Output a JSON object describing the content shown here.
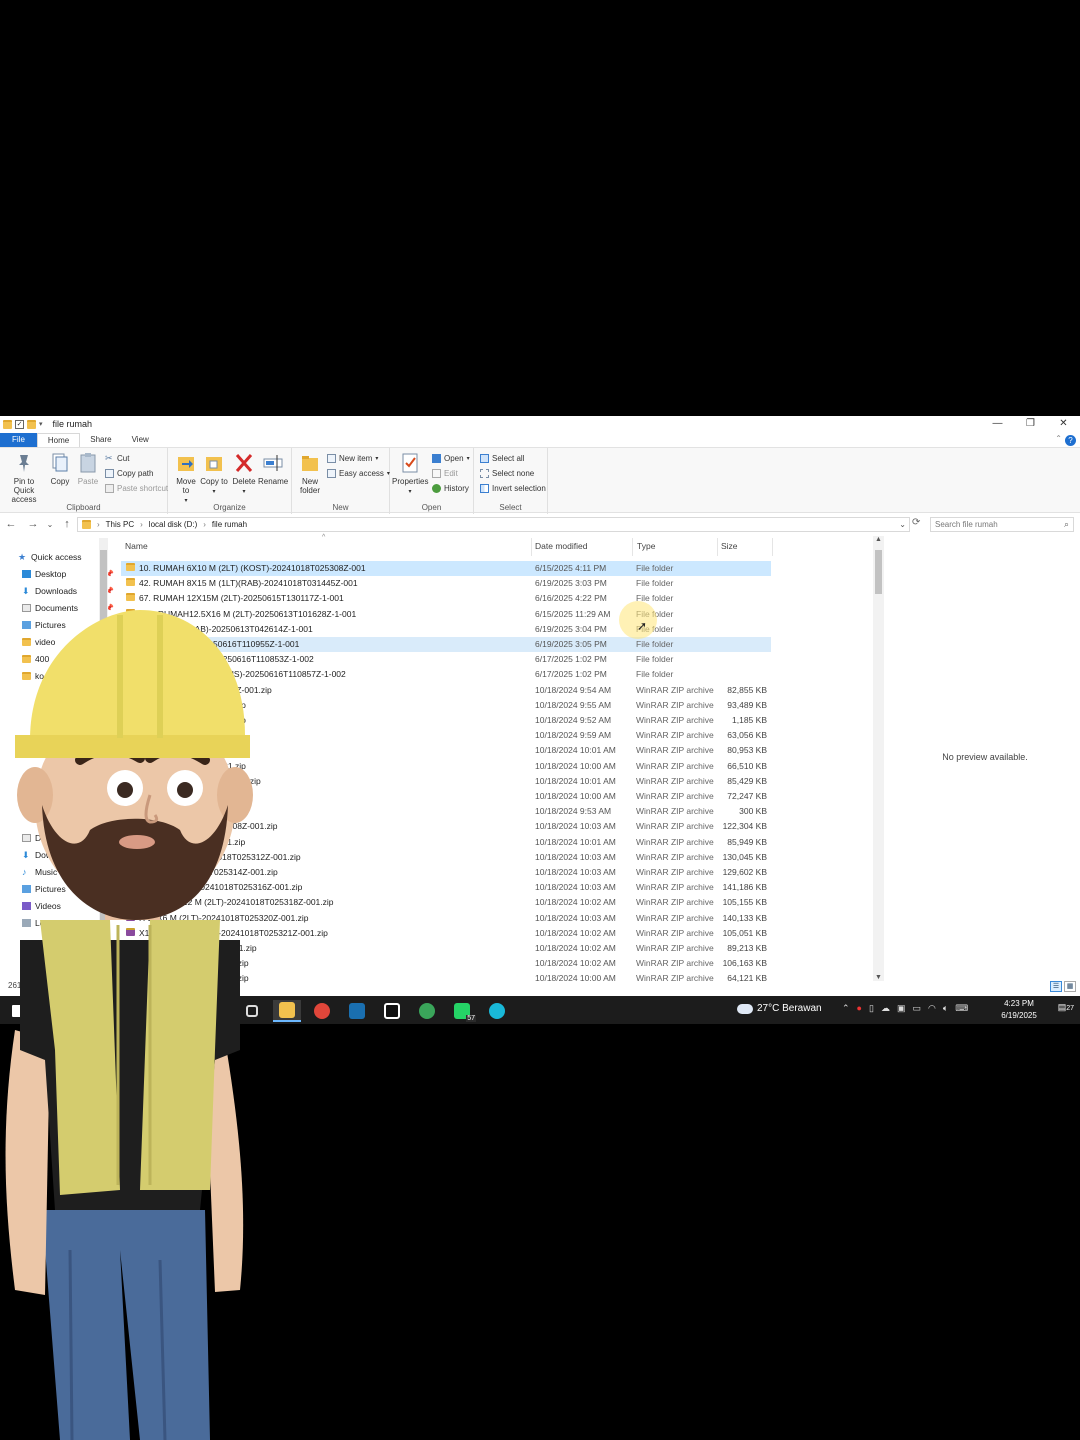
{
  "window": {
    "title": "file rumah",
    "controls": [
      "—",
      "❐",
      "✕"
    ]
  },
  "ribbon_tabs": [
    "File",
    "Home",
    "Share",
    "View"
  ],
  "ribbon": {
    "clipboard": {
      "label": "Clipboard",
      "pin": "Pin to Quick access",
      "copy": "Copy",
      "paste": "Paste",
      "cut": "Cut",
      "copy_path": "Copy path",
      "paste_shortcut": "Paste shortcut"
    },
    "organize": {
      "label": "Organize",
      "move_to": "Move to",
      "copy_to": "Copy to",
      "delete": "Delete",
      "rename": "Rename"
    },
    "new": {
      "label": "New",
      "new_folder": "New folder",
      "new_item": "New item",
      "easy_access": "Easy access"
    },
    "open": {
      "label": "Open",
      "properties": "Properties",
      "open": "Open",
      "edit": "Edit",
      "history": "History"
    },
    "select": {
      "label": "Select",
      "select_all": "Select all",
      "select_none": "Select none",
      "invert": "Invert selection"
    }
  },
  "address": {
    "crumbs": [
      "This PC",
      "local disk (D:)",
      "file rumah"
    ],
    "search_placeholder": "Search file rumah"
  },
  "nav_pane": {
    "items": [
      {
        "label": "Quick access",
        "icon": "star-icon",
        "pinned": false
      },
      {
        "label": "Desktop",
        "icon": "desktop-icon",
        "pinned": true
      },
      {
        "label": "Downloads",
        "icon": "download-icon",
        "pinned": true
      },
      {
        "label": "Documents",
        "icon": "document-icon",
        "pinned": true
      },
      {
        "label": "Pictures",
        "icon": "pictures-icon",
        "pinned": false
      },
      {
        "label": "video",
        "icon": "folder-icon",
        "pinned": false
      },
      {
        "label": "400",
        "icon": "folder-icon",
        "pinned": false
      },
      {
        "label": "ko",
        "icon": "folder-icon",
        "pinned": false
      },
      {
        "label": "Docu",
        "icon": "document-icon",
        "pinned": false
      },
      {
        "label": "Downl",
        "icon": "download-icon",
        "pinned": false
      },
      {
        "label": "Music",
        "icon": "music-icon",
        "pinned": false
      },
      {
        "label": "Pictures",
        "icon": "pictures-icon",
        "pinned": false
      },
      {
        "label": "Videos",
        "icon": "videos-icon",
        "pinned": false
      },
      {
        "label": "Local Disk",
        "icon": "drive-icon",
        "pinned": false
      }
    ]
  },
  "columns": {
    "name": "Name",
    "date": "Date modified",
    "type": "Type",
    "size": "Size"
  },
  "files": [
    {
      "name": "10. RUMAH 6X10 M (2LT) (KOST)-20241018T025308Z-001",
      "date": "6/15/2025 4:11 PM",
      "type": "File folder",
      "size": "",
      "kind": "folder",
      "state": "selected"
    },
    {
      "name": "42. RUMAH 8X15 M (1LT)(RAB)-20241018T031445Z-001",
      "date": "6/19/2025 3:03 PM",
      "type": "File folder",
      "size": "",
      "kind": "folder",
      "state": ""
    },
    {
      "name": "67. RUMAH 12X15M (2LT)-20250615T130117Z-1-001",
      "date": "6/16/2025 4:22 PM",
      "type": "File folder",
      "size": "",
      "kind": "folder",
      "state": ""
    },
    {
      "name": "#07. RUMAH12.5X16 M (2LT)-20250613T101628Z-1-001",
      "date": "6/15/2025 11:29 AM",
      "type": "File folder",
      "size": "",
      "kind": "folder",
      "state": ""
    },
    {
      "name": "X10 M (1LT)(RAB)-20250613T042614Z-1-001",
      "date": "6/19/2025 3:04 PM",
      "type": "File folder",
      "size": "",
      "kind": "folder",
      "state": ""
    },
    {
      "name": "M (2 LT) (RAB)-20250616T110955Z-1-001",
      "date": "6/19/2025 3:05 PM",
      "type": "File folder",
      "size": "",
      "kind": "folder",
      "state": "selected2"
    },
    {
      "name": "ium(sketchup only)-20250616T110853Z-1-002",
      "date": "6/17/2025 1:02 PM",
      "type": "File folder",
      "size": "",
      "kind": "folder",
      "state": ""
    },
    {
      "name": "DESAIN RUMAH (BONUS)-20250616T110857Z-1-002",
      "date": "6/17/2025 1:02 PM",
      "type": "File folder",
      "size": "",
      "kind": "folder",
      "state": ""
    },
    {
      "name": "(RAB)-20241018T025241Z-001.zip",
      "date": "10/18/2024 9:54 AM",
      "type": "WinRAR ZIP archive",
      "size": "82,855 KB",
      "kind": "zip",
      "state": ""
    },
    {
      "name": "20241018T025244Z-001.zip",
      "date": "10/18/2024 9:55 AM",
      "type": "WinRAR ZIP archive",
      "size": "93,489 KB",
      "kind": "zip",
      "state": ""
    },
    {
      "name": "20241018T025246Z-001.zip",
      "date": "10/18/2024 9:52 AM",
      "type": "WinRAR ZIP archive",
      "size": "1,185 KB",
      "kind": "zip",
      "state": ""
    },
    {
      "name": "1018T025249Z-001.zip",
      "date": "10/18/2024 9:59 AM",
      "type": "WinRAR ZIP archive",
      "size": "63,056 KB",
      "kind": "zip",
      "state": ""
    },
    {
      "name": "018T025256Z-001.zip",
      "date": "10/18/2024 10:01 AM",
      "type": "WinRAR ZIP archive",
      "size": "80,953 KB",
      "kind": "zip",
      "state": ""
    },
    {
      "name": "20241018T025258Z-001.zip",
      "date": "10/18/2024 10:00 AM",
      "type": "WinRAR ZIP archive",
      "size": "66,510 KB",
      "kind": "zip",
      "state": ""
    },
    {
      "name": "LT)-20241018T025301Z-001.zip",
      "date": "10/18/2024 10:01 AM",
      "type": "WinRAR ZIP archive",
      "size": "85,429 KB",
      "kind": "zip",
      "state": ""
    },
    {
      "name": "20241018T025303Z-001.zip",
      "date": "10/18/2024 10:00 AM",
      "type": "WinRAR ZIP archive",
      "size": "72,247 KB",
      "kind": "zip",
      "state": ""
    },
    {
      "name": "20241018T025306Z-001.zip",
      "date": "10/18/2024 9:53 AM",
      "type": "WinRAR ZIP archive",
      "size": "300 KB",
      "kind": "zip",
      "state": ""
    },
    {
      "name": "(KOST)-20241018T025308Z-001.zip",
      "date": "10/18/2024 10:03 AM",
      "type": "WinRAR ZIP archive",
      "size": "122,304 KB",
      "kind": "zip",
      "state": ""
    },
    {
      "name": "20241018T025311Z-001.zip",
      "date": "10/18/2024 10:01 AM",
      "type": "WinRAR ZIP archive",
      "size": "85,949 KB",
      "kind": "zip",
      "state": ""
    },
    {
      "name": "(KOST)(RAB)-20241018T025312Z-001.zip",
      "date": "10/18/2024 10:03 AM",
      "type": "WinRAR ZIP archive",
      "size": "130,045 KB",
      "kind": "zip",
      "state": ""
    },
    {
      "name": "M (1LT)-20241018T025314Z-001.zip",
      "date": "10/18/2024 10:03 AM",
      "type": "WinRAR ZIP archive",
      "size": "129,602 KB",
      "kind": "zip",
      "state": ""
    },
    {
      "name": "X14.5 M (2LT)-20241018T025316Z-001.zip",
      "date": "10/18/2024 10:03 AM",
      "type": "WinRAR ZIP archive",
      "size": "141,186 KB",
      "kind": "zip",
      "state": ""
    },
    {
      "name": "RUMAH 6X12 M (2LT)-20241018T025318Z-001.zip",
      "date": "10/18/2024 10:02 AM",
      "type": "WinRAR ZIP archive",
      "size": "105,155 KB",
      "kind": "zip",
      "state": ""
    },
    {
      "name": "H 10X6 M (2LT)-20241018T025320Z-001.zip",
      "date": "10/18/2024 10:03 AM",
      "type": "WinRAR ZIP archive",
      "size": "140,133 KB",
      "kind": "zip",
      "state": ""
    },
    {
      "name": "X13 M (RUKO) (1LT)-20241018T025321Z-001.zip",
      "date": "10/18/2024 10:02 AM",
      "type": "WinRAR ZIP archive",
      "size": "105,051 KB",
      "kind": "zip",
      "state": ""
    },
    {
      "name": "T)-20241018T025323Z-001.zip",
      "date": "10/18/2024 10:02 AM",
      "type": "WinRAR ZIP archive",
      "size": "89,213 KB",
      "kind": "zip",
      "state": ""
    },
    {
      "name": "-20241018T025326Z-001.zip",
      "date": "10/18/2024 10:02 AM",
      "type": "WinRAR ZIP archive",
      "size": "106,163 KB",
      "kind": "zip",
      "state": ""
    },
    {
      "name": "-20241018T025329Z-001.zip",
      "date": "10/18/2024 10:00 AM",
      "type": "WinRAR ZIP archive",
      "size": "64,121 KB",
      "kind": "zip",
      "state": ""
    }
  ],
  "preview_text": "No preview available.",
  "status_count": "261",
  "taskbar": {
    "apps": [
      {
        "name": "task-view-icon",
        "color": "#1c1c1c"
      },
      {
        "name": "file-explorer-icon",
        "color": "#f2c14e"
      },
      {
        "name": "chrome-icon",
        "color": "#e0463a"
      },
      {
        "name": "sketchup-icon",
        "color": "#1a6fb0"
      },
      {
        "name": "capcut-icon",
        "color": "#ffffff"
      },
      {
        "name": "chrome-profile-icon",
        "color": "#3aa55a"
      },
      {
        "name": "whatsapp-icon",
        "color": "#25d366"
      },
      {
        "name": "canva-icon",
        "color": "#19b8d8"
      }
    ],
    "whatsapp_badge": "57",
    "weather": "27°C  Berawan",
    "time": "4:23 PM",
    "date": "6/19/2025",
    "notifications": "27"
  },
  "colors": {
    "accent": "#1e6fd0",
    "selection": "#cce8ff",
    "folder": "#f2c14e"
  }
}
